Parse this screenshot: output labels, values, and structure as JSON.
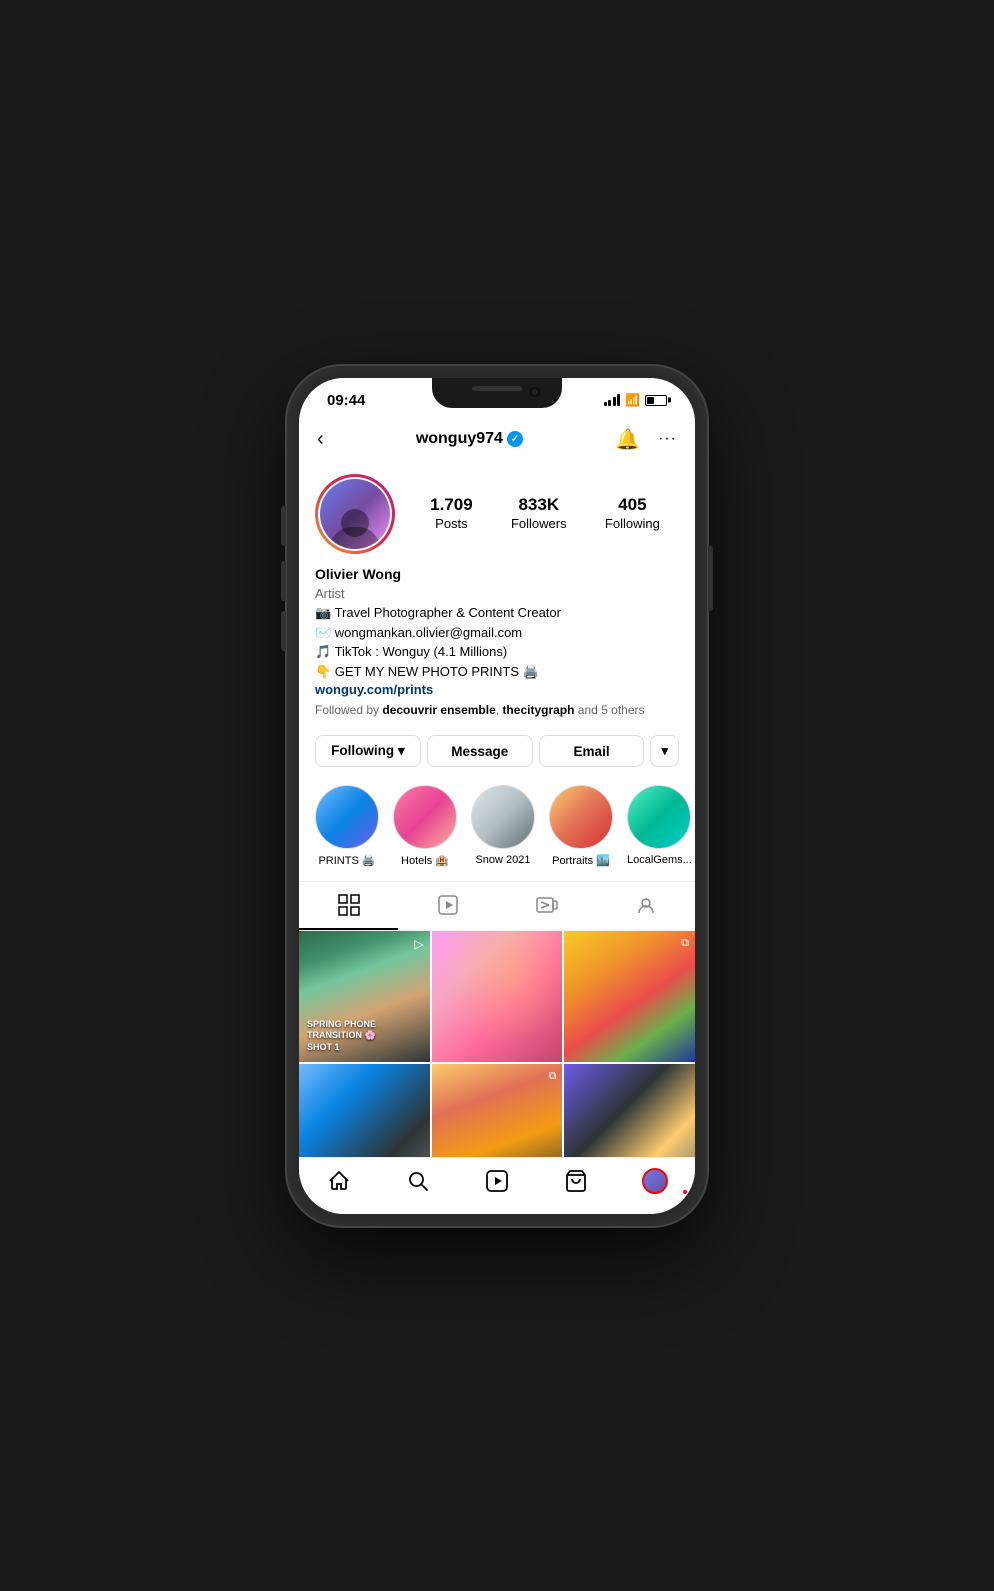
{
  "phone": {
    "status_bar": {
      "time": "09:44"
    },
    "header": {
      "username": "wonguy974",
      "back_label": "‹",
      "bell_label": "🔔",
      "more_label": "···"
    },
    "profile": {
      "name": "Olivier Wong",
      "role": "Artist",
      "bio_lines": [
        "📷 Travel Photographer & Content Creator",
        "✉️ wongmankan.olivier@gmail.com",
        "🎵 TikTok : Wonguy (4.1 Millions)",
        "👇 GET MY NEW PHOTO PRINTS 🖨️"
      ],
      "link": "wonguy.com/prints",
      "followed_by": "Followed by decouvrir ensemble, thecitygraph and 5 others",
      "stats": {
        "posts": {
          "value": "1.709",
          "label": "Posts"
        },
        "followers": {
          "value": "833K",
          "label": "Followers"
        },
        "following": {
          "value": "405",
          "label": "Following"
        }
      }
    },
    "action_buttons": {
      "following": "Following ▾",
      "message": "Message",
      "email": "Email",
      "more": "▾"
    },
    "highlights": [
      {
        "label": "PRINTS 🖨️",
        "class": "hl-1"
      },
      {
        "label": "Hotels 🏨",
        "class": "hl-2"
      },
      {
        "label": "Snow 2021",
        "class": "hl-3"
      },
      {
        "label": "Portraits 🏙️",
        "class": "hl-4"
      },
      {
        "label": "LocalGems...",
        "class": "hl-5"
      }
    ],
    "tabs": [
      {
        "id": "grid",
        "icon": "⊞",
        "active": true
      },
      {
        "id": "reels",
        "icon": "▷"
      },
      {
        "id": "igtv",
        "icon": "⬜▷"
      },
      {
        "id": "tagged",
        "icon": "👤"
      }
    ],
    "grid_photos": [
      {
        "class": "photo-1",
        "overlay_icon": "▷",
        "text": "SPRING PHONE TRANSITION 🌸\nSHOT 1"
      },
      {
        "class": "photo-2",
        "overlay_icon": "",
        "text": ""
      },
      {
        "class": "photo-3",
        "overlay_icon": "⬜",
        "text": ""
      },
      {
        "class": "photo-4",
        "overlay_icon": "",
        "text": ""
      },
      {
        "class": "photo-5",
        "overlay_icon": "⬜",
        "text": ""
      },
      {
        "class": "photo-6",
        "overlay_icon": "",
        "text": ""
      }
    ],
    "bottom_nav": {
      "home": "🏠",
      "search": "🔍",
      "reels": "▷",
      "shop": "🛍️",
      "profile": "avatar"
    }
  }
}
